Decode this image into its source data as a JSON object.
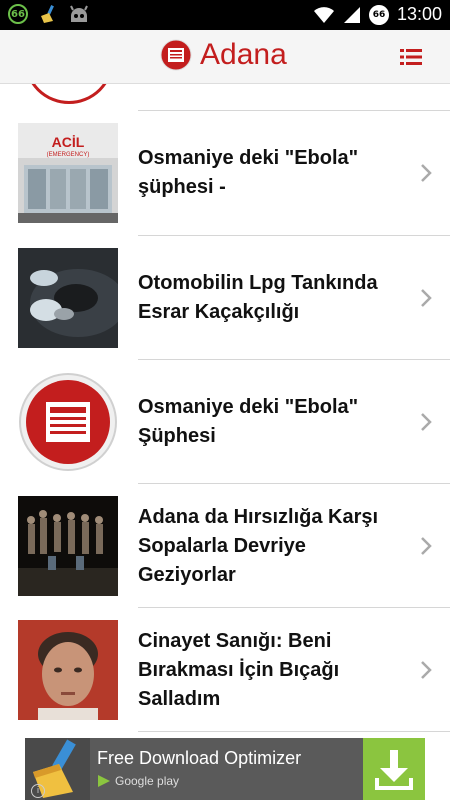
{
  "status_bar": {
    "time": "13:00",
    "badge_left": "66",
    "badge_right": "66"
  },
  "app_bar": {
    "title": "Adana",
    "brand_color": "#c31e1e"
  },
  "news": [
    {
      "title": "Osmaniye deki \"Ebola\" şüphesi -",
      "thumb": "hospital-entrance-photo",
      "thumb_text": "ACİL",
      "thumb_subtext": "(EMERGENCY)"
    },
    {
      "title": "Otomobilin Lpg Tankında Esrar Kaçakçılığı",
      "thumb": "gloved-hands-lpg-tank-photo"
    },
    {
      "title": "Osmaniye deki \"Ebola\" Şüphesi",
      "thumb": "newspaper-placeholder-icon"
    },
    {
      "title": "Adana da Hırsızlığa Karşı Sopalarla Devriye Geziyorlar",
      "thumb": "night-patrol-group-photo"
    },
    {
      "title": "Cinayet Sanığı: Beni Bırakması İçin Bıçağı Salladım",
      "thumb": "suspect-portrait-photo"
    }
  ],
  "ad": {
    "title": "Free Download Optimizer",
    "store_label": "Google play",
    "info_symbol": "i"
  }
}
